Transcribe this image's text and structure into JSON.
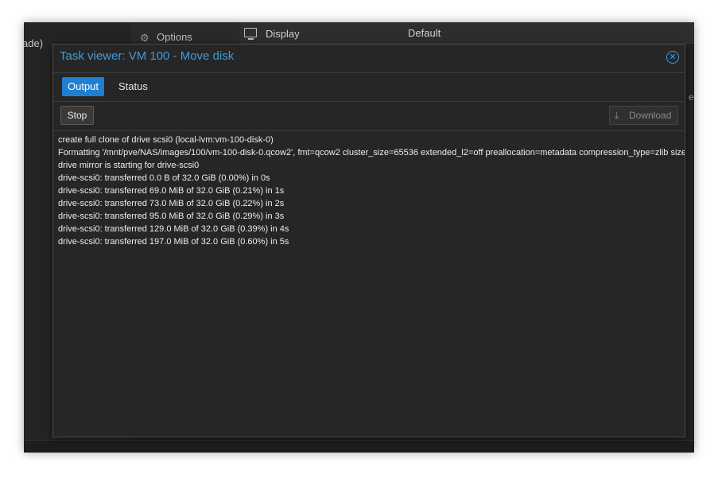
{
  "background": {
    "left_text": "ade)",
    "options_label": "Options",
    "display_label": "Display",
    "default_value": "Default",
    "edge_text": "e"
  },
  "modal": {
    "title": "Task viewer: VM 100 - Move disk",
    "tabs": [
      {
        "label": "Output",
        "active": true
      },
      {
        "label": "Status",
        "active": false
      }
    ],
    "toolbar": {
      "stop_label": "Stop",
      "download_label": "Download",
      "download_enabled": false
    },
    "log": [
      "create full clone of drive scsi0 (local-lvm:vm-100-disk-0)",
      "Formatting '/mnt/pve/NAS/images/100/vm-100-disk-0.qcow2', fmt=qcow2 cluster_size=65536 extended_l2=off preallocation=metadata compression_type=zlib size",
      "drive mirror is starting for drive-scsi0",
      "drive-scsi0: transferred 0.0 B of 32.0 GiB (0.00%) in 0s",
      "drive-scsi0: transferred 69.0 MiB of 32.0 GiB (0.21%) in 1s",
      "drive-scsi0: transferred 73.0 MiB of 32.0 GiB (0.22%) in 2s",
      "drive-scsi0: transferred 95.0 MiB of 32.0 GiB (0.29%) in 3s",
      "drive-scsi0: transferred 129.0 MiB of 32.0 GiB (0.39%) in 4s",
      "drive-scsi0: transferred 197.0 MiB of 32.0 GiB (0.60%) in 5s"
    ]
  },
  "colors": {
    "accent": "#1f7fd1",
    "title": "#3d9be0",
    "panel": "#262626"
  },
  "icons": {
    "options": "gear-icon",
    "display": "monitor-icon",
    "close": "close-icon",
    "download": "download-icon"
  }
}
